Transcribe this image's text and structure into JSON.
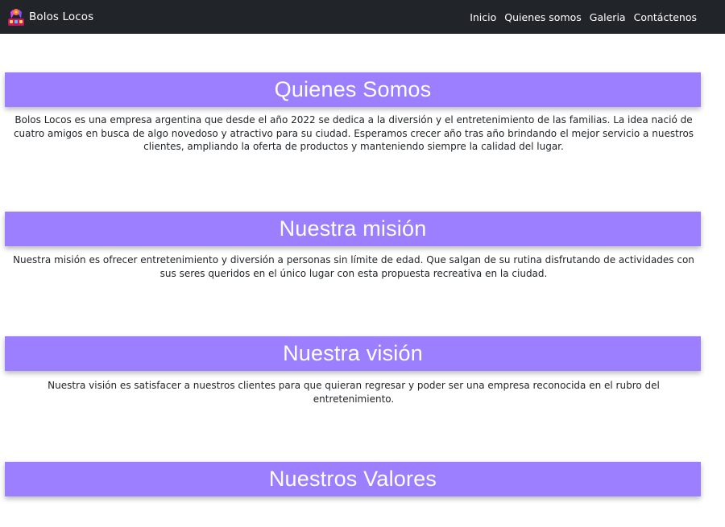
{
  "navbar": {
    "brand": "Bolos Locos",
    "links": [
      "Inicio",
      "Quienes somos",
      "Galeria",
      "Contáctenos"
    ]
  },
  "sections": [
    {
      "title": "Quienes Somos",
      "text": "Bolos Locos es una empresa argentina que desde el año 2022 se dedica a la diversión y el entretenimiento de las familias. La idea nació de cuatro amigos en busca de algo novedoso y atractivo para su ciudad. Esperamos crecer año tras año brindando el mejor servicio a nuestros clientes, ampliando la oferta de productos y manteniendo siempre la calidad del lugar."
    },
    {
      "title": "Nuestra misión",
      "text": "Nuestra misión es ofrecer entretenimiento y diversión a personas sin límite de edad. Que salgan de su rutina disfrutando de actividades con sus seres queridos en el único lugar con esta propuesta recreativa en la ciudad."
    },
    {
      "title": "Nuestra visión",
      "text": "Nuestra visión es satisfacer a nuestros clientes para que quieran regresar y poder ser una empresa reconocida en el rubro del entretenimiento."
    },
    {
      "title": "Nuestros Valores",
      "text": ""
    }
  ],
  "colors": {
    "navbar_bg": "#212529",
    "banner_bg": "#9b7fff",
    "banner_text": "#ffffff"
  }
}
